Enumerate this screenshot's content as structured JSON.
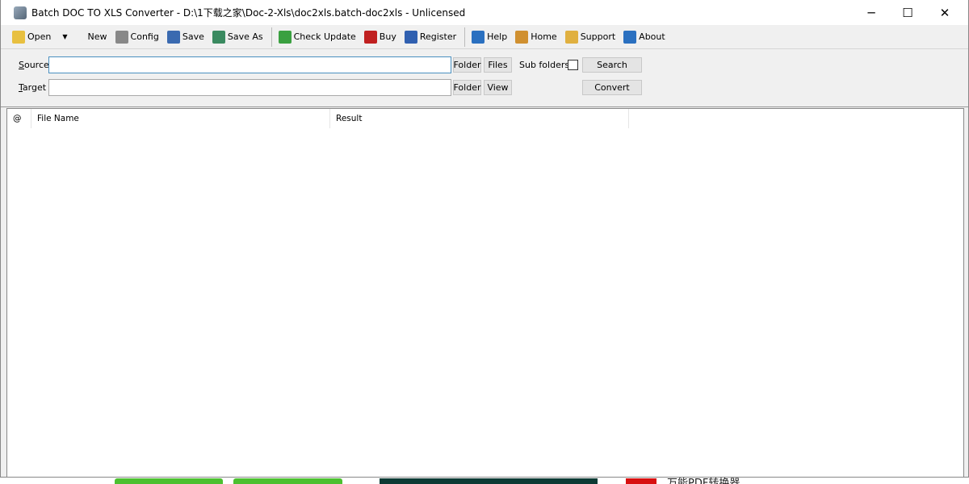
{
  "window": {
    "title": "Batch DOC TO XLS Converter - D:\\1下载之家\\Doc-2-Xls\\doc2xls.batch-doc2xls - Unlicensed",
    "minimize": "─",
    "maximize": "☐",
    "close": "✕"
  },
  "toolbar": [
    {
      "label": "Open",
      "icon": "open-folder-icon",
      "color": "#e8c040"
    },
    {
      "label": "New",
      "icon": "new-document-icon",
      "color": "#f0f0f0"
    },
    {
      "label": "Config",
      "icon": "tools-icon",
      "color": "#888888"
    },
    {
      "label": "Save",
      "icon": "save-icon",
      "color": "#3a6ab0"
    },
    {
      "label": "Save As",
      "icon": "save-as-icon",
      "color": "#3a8a60"
    },
    {
      "label": "Check Update",
      "icon": "refresh-icon",
      "color": "#3aa040"
    },
    {
      "label": "Buy",
      "icon": "cart-icon",
      "color": "#c02020"
    },
    {
      "label": "Register",
      "icon": "user-icon",
      "color": "#3060b0"
    },
    {
      "label": "Help",
      "icon": "help-icon",
      "color": "#2a70c0"
    },
    {
      "label": "Home",
      "icon": "home-icon",
      "color": "#d09030"
    },
    {
      "label": "Support",
      "icon": "mail-icon",
      "color": "#e0b040"
    },
    {
      "label": "About",
      "icon": "info-icon",
      "color": "#2a70c0"
    }
  ],
  "form": {
    "source_label": "Source",
    "source_value": "",
    "target_label": "Target",
    "target_value": "",
    "folder": "Folder",
    "files": "Files",
    "view": "View",
    "subfolders": "Sub folders",
    "search": "Search",
    "convert": "Convert"
  },
  "list": {
    "columns": [
      "@",
      "File Name",
      "Result"
    ]
  },
  "background": {
    "text": "万能PDF转换器"
  }
}
